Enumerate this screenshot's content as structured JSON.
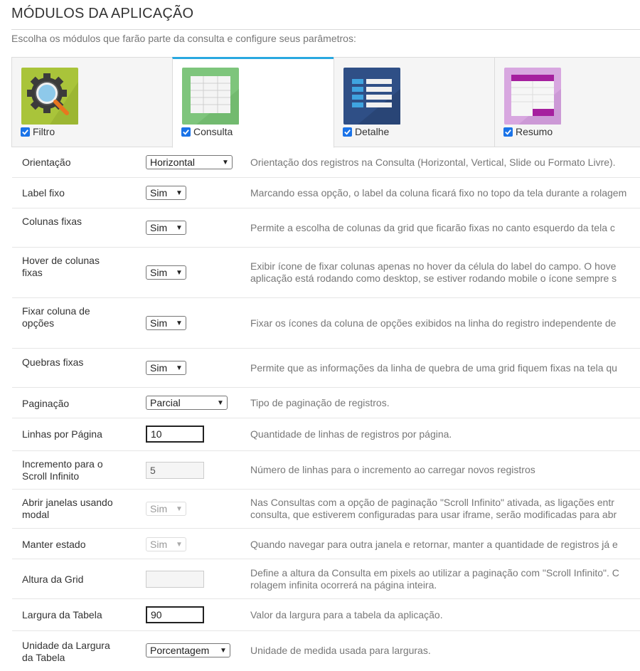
{
  "header": {
    "title": "MÓDULOS DA APLICAÇÃO",
    "subtitle": "Escolha os módulos que farão parte da consulta e configure seus parâmetros:"
  },
  "tabs": [
    {
      "label": "Filtro",
      "checked": true,
      "icon": "search-gear-icon"
    },
    {
      "label": "Consulta",
      "checked": true,
      "icon": "grid-icon",
      "active": true
    },
    {
      "label": "Detalhe",
      "checked": true,
      "icon": "detail-list-icon"
    },
    {
      "label": "Resumo",
      "checked": true,
      "icon": "summary-table-icon"
    }
  ],
  "rows": [
    {
      "label": "Orientação",
      "value": "Horizontal",
      "desc": "Orientação dos registros na Consulta (Horizontal, Vertical, Slide ou Formato Livre)."
    },
    {
      "label": "Label fixo",
      "value": "Sim",
      "desc": "Marcando essa opção, o label da coluna ficará fixo no topo da tela durante a rolagem"
    },
    {
      "label": "Colunas fixas",
      "value": "Sim",
      "desc": "Permite a escolha de colunas da grid que ficarão fixas no canto esquerdo da tela c"
    },
    {
      "label_line1": "Hover de colunas",
      "label_line2": "fixas",
      "value": "Sim",
      "desc_line1": "Exibir ícone de fixar colunas apenas no hover da célula do label do campo. O hove",
      "desc_line2": "aplicação está rodando como desktop, se estiver rodando mobile o ícone sempre s"
    },
    {
      "label_line1": "Fixar coluna de",
      "label_line2": "opções",
      "value": "Sim",
      "desc": "Fixar os ícones da coluna de opções exibidos na linha do registro independente de"
    },
    {
      "label": "Quebras fixas",
      "value": "Sim",
      "desc": "Permite que as informações da linha de quebra de uma grid fiquem fixas na tela qu"
    },
    {
      "label": "Paginação",
      "value": "Parcial",
      "desc": "Tipo de paginação de registros."
    },
    {
      "label": "Linhas por Página",
      "value": "10",
      "desc": "Quantidade de linhas de registros por página."
    },
    {
      "label_line1": "Incremento para o",
      "label_line2": "Scroll Infinito",
      "value": "5",
      "desc": "Número de linhas para o incremento ao carregar novos registros"
    },
    {
      "label_line1": "Abrir janelas usando",
      "label_line2": "modal",
      "value": "Sim",
      "desc_line1": "Nas Consultas com a opção de paginação \"Scroll Infinito\" ativada, as ligações entr",
      "desc_line2": "consulta, que estiverem configuradas para usar iframe, serão modificadas para abr"
    },
    {
      "label": "Manter estado",
      "value": "Sim",
      "desc": "Quando navegar para outra janela e retornar, manter a quantidade de registros já e"
    },
    {
      "label": "Altura da Grid",
      "value": "",
      "desc_line1": "Define a altura da Consulta em pixels ao utilizar a paginação com \"Scroll Infinito\". C",
      "desc_line2": "rolagem infinita ocorrerá na página inteira."
    },
    {
      "label": "Largura da Tabela",
      "value": "90",
      "desc": "Valor da largura para a tabela da aplicação."
    },
    {
      "label_line1": "Unidade da Largura",
      "label_line2": "da Tabela",
      "value": "Porcentagem",
      "desc": "Unidade de medida usada para larguras."
    }
  ]
}
